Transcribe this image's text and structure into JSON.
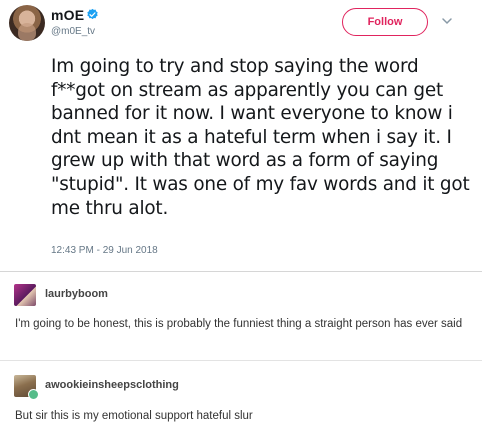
{
  "tweet": {
    "display_name": "mOE",
    "handle": "@m0E_tv",
    "follow_label": "Follow",
    "text": "Im going to try and stop saying the word f**got on stream as apparently you can get banned for it now. I want everyone to know i dnt mean it as a hateful term when i say it. I grew up with that word as a form of saying \"stupid\". It was one of my fav words and it got me thru alot.",
    "timestamp": "12:43 PM - 29 Jun 2018",
    "icons": {
      "verified": "verified-badge-icon",
      "menu": "chevron-down-icon"
    },
    "colors": {
      "verified": "#1da1f2",
      "follow": "#e0245e"
    }
  },
  "posts": [
    {
      "username": "laurbyboom",
      "body": "I'm going to be honest, this is probably the funniest thing a straight person has ever said"
    },
    {
      "username": "awookieinsheepsclothing",
      "body": "But sir this is my emotional support hateful slur"
    }
  ]
}
